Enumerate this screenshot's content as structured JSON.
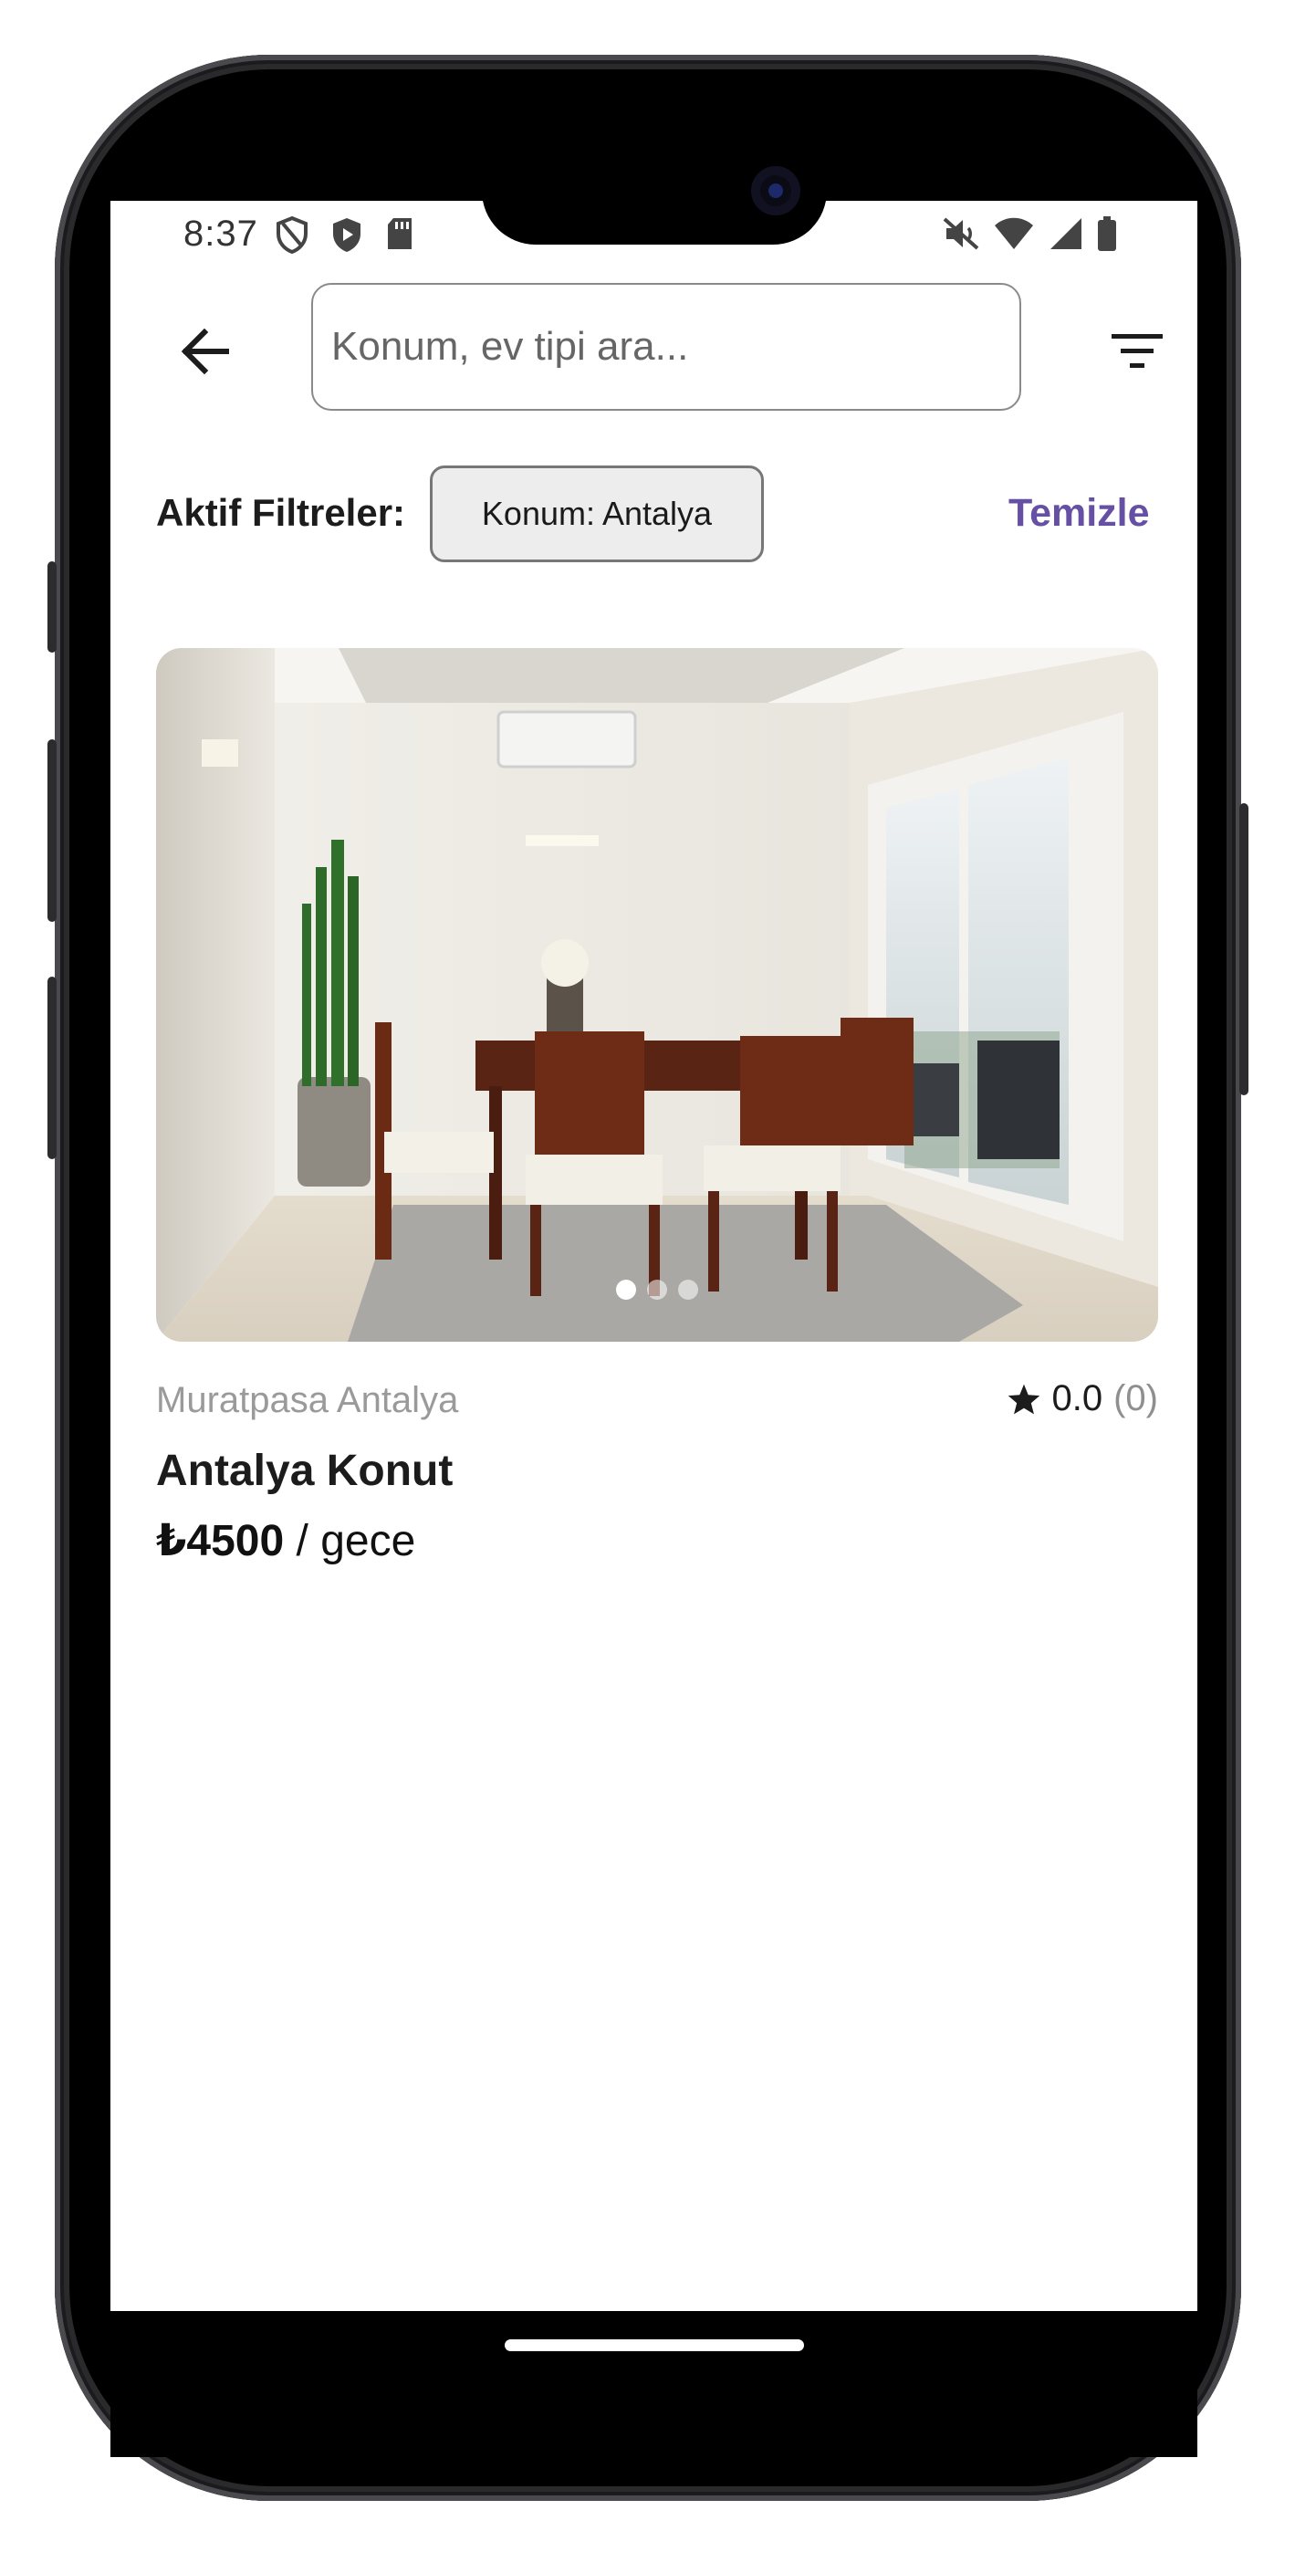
{
  "status_bar": {
    "time": "8:37",
    "left_icons": [
      "shield-outline-icon",
      "shield-play-icon",
      "sd-card-icon"
    ],
    "right_icons": [
      "mute-icon",
      "wifi-icon",
      "signal-icon",
      "battery-icon"
    ]
  },
  "header": {
    "search_placeholder": "Konum, ev tipi ara...",
    "back_icon": "arrow-left-icon",
    "filter_icon": "filter-list-icon"
  },
  "filters": {
    "label": "Aktif Filtreler:",
    "chips": [
      "Konum: Antalya"
    ],
    "clear_label": "Temizle"
  },
  "listing": {
    "location": "Muratpasa Antalya",
    "rating": "0.0",
    "review_count": "(0)",
    "title": "Antalya Konut",
    "price_amount": "₺4500",
    "price_unit": " / gece",
    "image_count": 3,
    "active_image": 1
  },
  "colors": {
    "accent": "#6650a4",
    "chip_bg": "#ededed"
  }
}
